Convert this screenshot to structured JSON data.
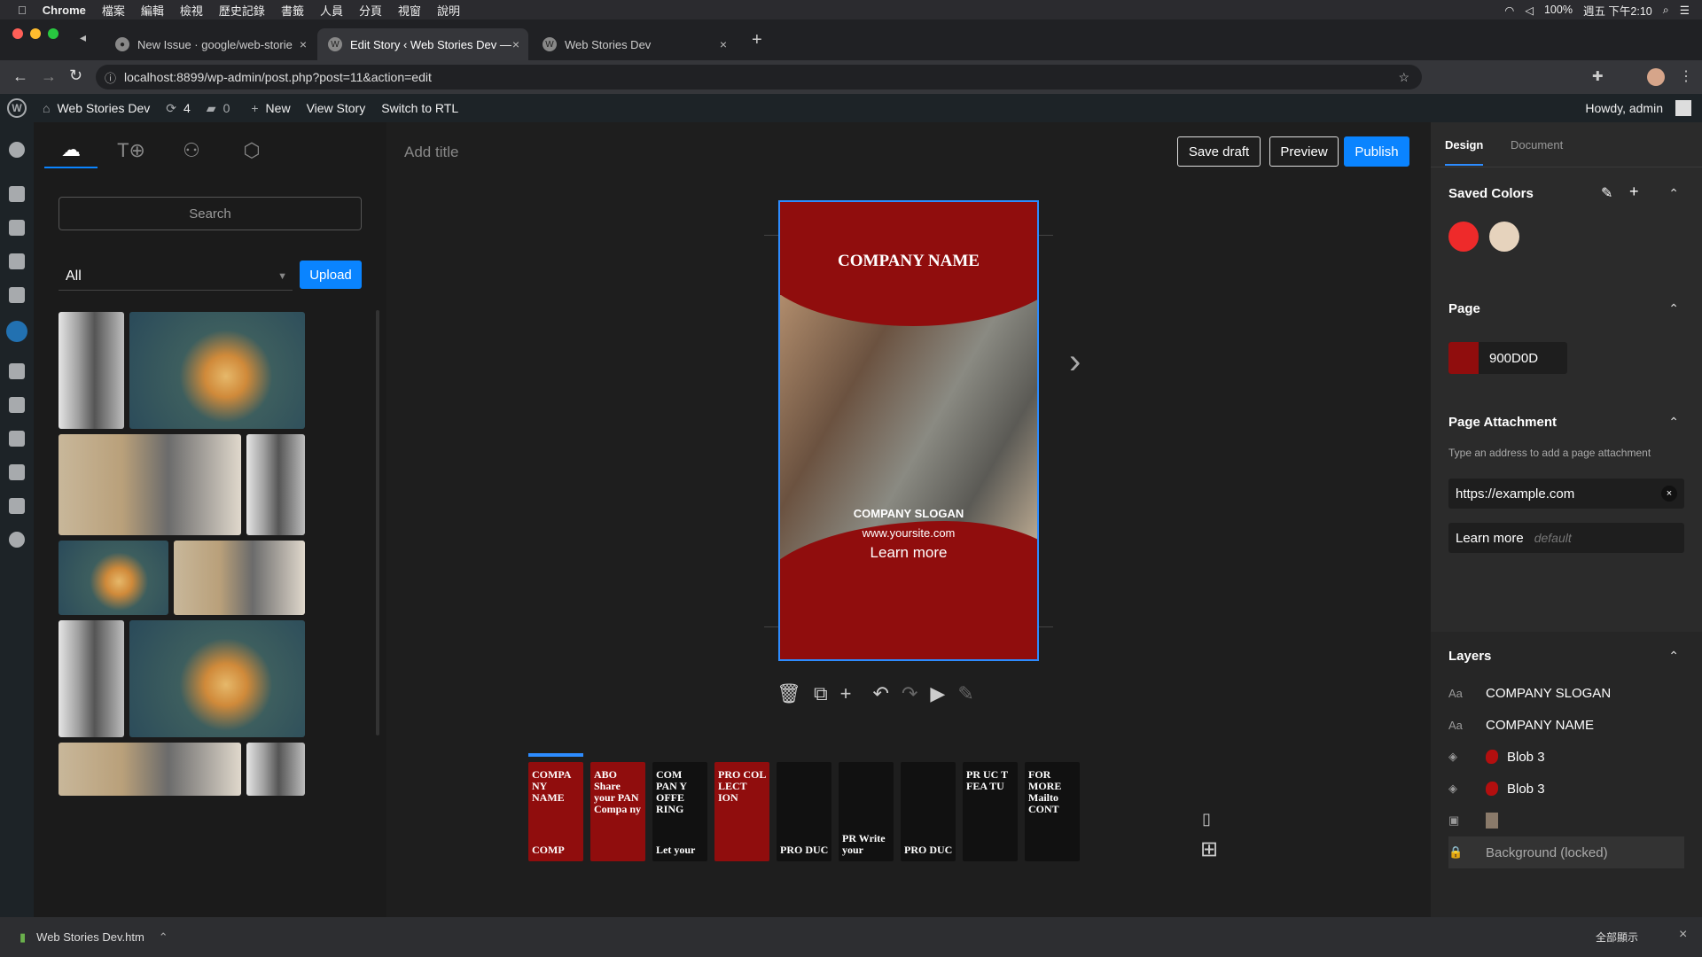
{
  "macbar": {
    "app": "Chrome",
    "menus": [
      "檔案",
      "編輯",
      "檢視",
      "歷史記錄",
      "書籤",
      "人員",
      "分頁",
      "視窗",
      "說明"
    ],
    "battery": "100%",
    "clock": "週五 下午2:10"
  },
  "tabs": [
    {
      "label": "New Issue · google/web-storie"
    },
    {
      "label": "Edit Story ‹ Web Stories Dev —"
    },
    {
      "label": "Web Stories Dev"
    }
  ],
  "url": "localhost:8899/wp-admin/post.php?post=11&action=edit",
  "wpbar": {
    "site": "Web Stories Dev",
    "updates": "4",
    "comments": "0",
    "new": "New",
    "view": "View Story",
    "rtl": "Switch to RTL",
    "howdy": "Howdy, admin"
  },
  "library": {
    "search_placeholder": "Search",
    "filter": "All",
    "upload": "Upload"
  },
  "editor": {
    "title_placeholder": "Add title",
    "save_draft": "Save draft",
    "preview": "Preview",
    "publish": "Publish"
  },
  "story": {
    "company": "COMPANY NAME",
    "slogan": "COMPANY SLOGAN",
    "site": "www.yoursite.com",
    "cta": "Learn more",
    "bg": "#900d0d"
  },
  "carousel": [
    {
      "text": "COMPA NY NAME",
      "foot": "COMP",
      "dark": false
    },
    {
      "text": "ABO Share your PAN Compa ny",
      "foot": "",
      "dark": false
    },
    {
      "text": "COM PAN Y OFFE RING",
      "foot": "Let your",
      "dark": true
    },
    {
      "text": "PRO COL LECT ION",
      "foot": "",
      "dark": false
    },
    {
      "text": "",
      "foot": "PRO DUC",
      "dark": true
    },
    {
      "text": "",
      "foot": "PR Write your",
      "dark": true
    },
    {
      "text": "",
      "foot": "PRO DUC",
      "dark": true
    },
    {
      "text": "PR UC T FEA TU",
      "foot": "",
      "dark": true
    },
    {
      "text": "FOR MORE Mailto CONT",
      "foot": "",
      "dark": true
    }
  ],
  "panel": {
    "tabs": [
      "Design",
      "Document"
    ],
    "saved_colors": "Saved Colors",
    "colors": [
      "#ee2a2a",
      "#e6d3bd"
    ],
    "page": "Page",
    "page_color": "900D0D",
    "attachment": "Page Attachment",
    "attachment_hint": "Type an address to add a page attachment",
    "attachment_url": "https://example.com",
    "cta_label": "Learn more",
    "cta_default": "default",
    "layers": "Layers",
    "layer_items": [
      {
        "icon": "Aa",
        "label": "COMPANY SLOGAN"
      },
      {
        "icon": "Aa",
        "label": "COMPANY NAME"
      },
      {
        "icon": "◈",
        "label": "Blob 3"
      },
      {
        "icon": "◈",
        "label": "Blob 3"
      },
      {
        "icon": "▣",
        "label": ""
      },
      {
        "icon": "🔒",
        "label": "Background (locked)"
      }
    ]
  },
  "download": {
    "file": "Web Stories Dev.htm",
    "show_all": "全部顯示"
  }
}
